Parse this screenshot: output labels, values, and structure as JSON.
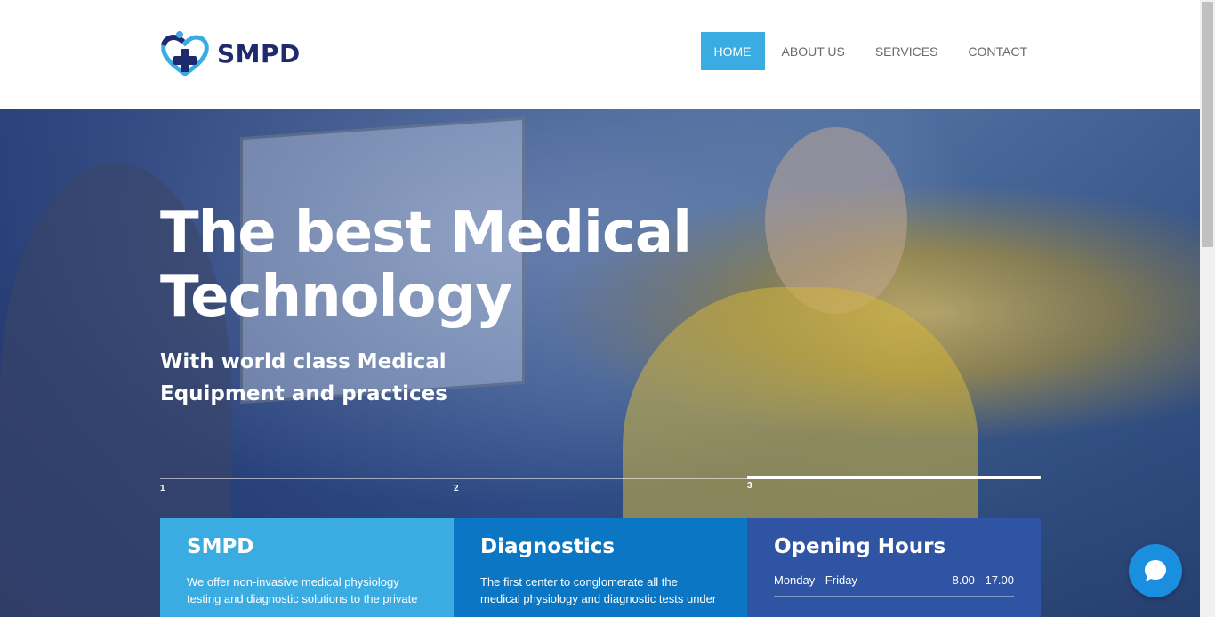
{
  "header": {
    "logo_text": "SMPD",
    "nav": [
      {
        "label": "HOME",
        "active": true
      },
      {
        "label": "ABOUT US",
        "active": false
      },
      {
        "label": "SERVICES",
        "active": false
      },
      {
        "label": "CONTACT",
        "active": false
      }
    ]
  },
  "hero": {
    "title_line1": "The best Medical",
    "title_line2": "Technology",
    "subtitle_line1": "With world class Medical",
    "subtitle_line2": "Equipment and practices",
    "slides": [
      "1",
      "2",
      "3"
    ],
    "active_slide": "3"
  },
  "boxes": {
    "smpd": {
      "title": "SMPD",
      "text_line1": "We offer non-invasive medical physiology",
      "text_line2": "testing and diagnostic solutions to the private"
    },
    "diagnostics": {
      "title": "Diagnostics",
      "text_line1": "The first center to conglomerate all the",
      "text_line2": "medical physiology and diagnostic tests under"
    },
    "hours": {
      "title": "Opening Hours",
      "rows": [
        {
          "day": "Monday - Friday",
          "time": "8.00 - 17.00"
        }
      ]
    }
  },
  "colors": {
    "brand_navy": "#1f2a6d",
    "accent": "#3aace2",
    "box2": "#0a76c4",
    "box3": "#2f54a4",
    "chat": "#1a8fe0"
  },
  "icons": {
    "logo": "heart-cross-icon",
    "chat": "chat-bubble-icon"
  }
}
